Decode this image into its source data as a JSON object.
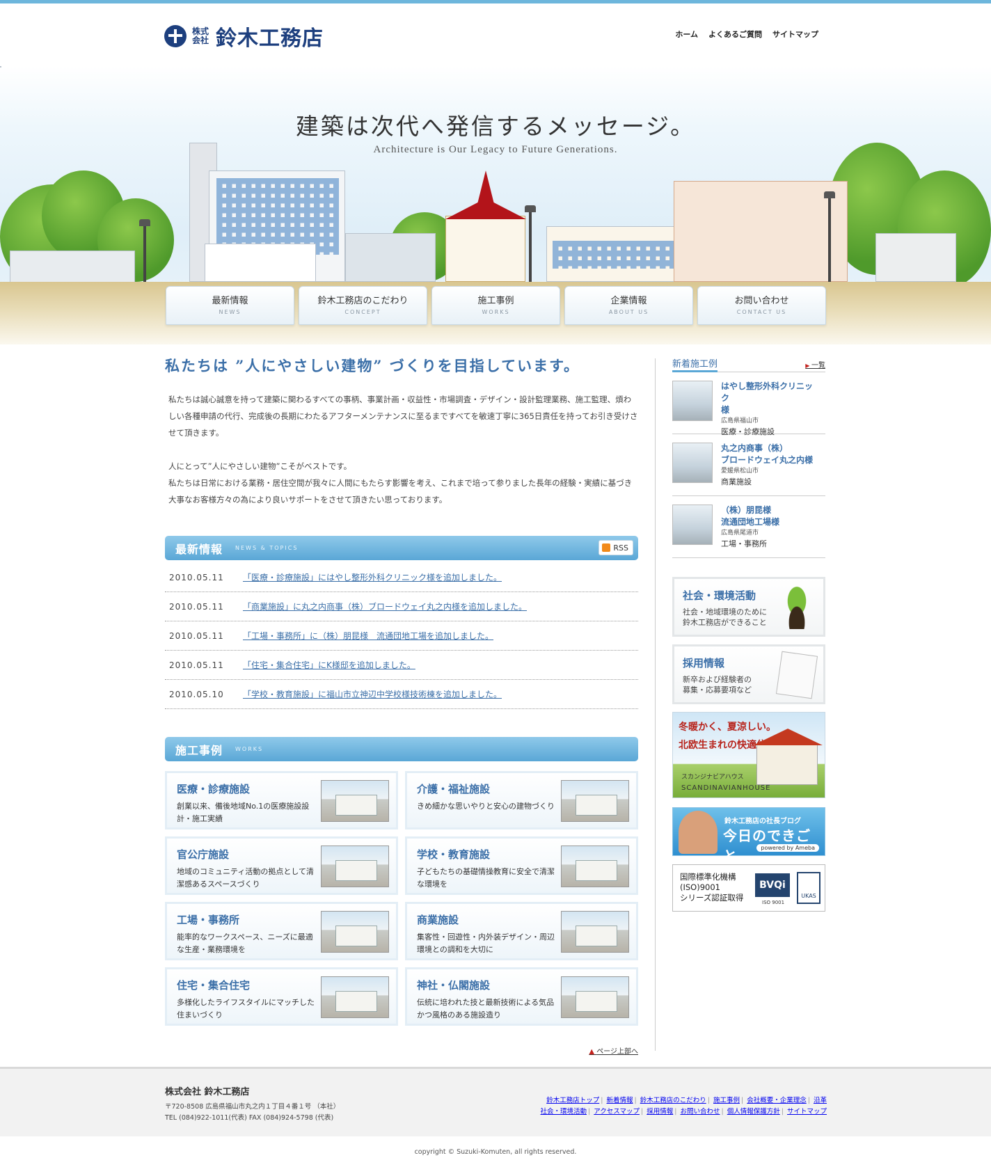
{
  "header": {
    "logo_small": "株式会社",
    "logo_main": "鈴木工務店",
    "top_nav": [
      "ホーム",
      "よくあるご質問",
      "サイトマップ"
    ]
  },
  "hero": {
    "title": "建築は次代へ発信するメッセージ。",
    "subtitle": "Architecture is Our Legacy to Future Generations."
  },
  "main_nav": [
    {
      "jp": "最新情報",
      "en": "NEWS"
    },
    {
      "jp": "鈴木工務店のこだわり",
      "en": "CONCEPT"
    },
    {
      "jp": "施工事例",
      "en": "WORKS"
    },
    {
      "jp": "企業情報",
      "en": "ABOUT US"
    },
    {
      "jp": "お問い合わせ",
      "en": "CONTACT US"
    }
  ],
  "intro": {
    "headline": "私たちは ”人にやさしい建物” づくりを目指しています。",
    "p1": "私たちは誠心誠意を持って建築に関わるすべての事柄、事業計画・収益性・市場調査・デザイン・設計監理業務、施工監理、煩わしい各種申請の代行、完成後の長期にわたるアフターメンテナンスに至るまですべてを敏速丁寧に365日責任を持ってお引き受けさせて頂きます。",
    "p2a": "人にとって”人にやさしい建物”こそがベストです。",
    "p2b": "私たちは日常における業務・居住空間が我々に人間にもたらす影響を考え、これまで培って参りました長年の経験・実績に基づき大事なお客様方々の為により良いサポートをさせて頂きたい思っております。"
  },
  "news": {
    "title": "最新情報",
    "subtitle": "NEWS & TOPICS",
    "rss": "RSS",
    "items": [
      {
        "date": "2010.05.11",
        "text": "「医療・診療施設」にはやし整形外科クリニック様を追加しました。"
      },
      {
        "date": "2010.05.11",
        "text": "「商業施設」に丸之内商事（株）ブロードウェイ丸之内様を追加しました。"
      },
      {
        "date": "2010.05.11",
        "text": "「工場・事務所」に（株）朋昆様　流通団地工場を追加しました。"
      },
      {
        "date": "2010.05.11",
        "text": "「住宅・集合住宅」にK様邸を追加しました。"
      },
      {
        "date": "2010.05.10",
        "text": "「学校・教育施設」に福山市立神辺中学校様技術棟を追加しました。"
      }
    ]
  },
  "works": {
    "title": "施工事例",
    "subtitle": "WORKS",
    "items": [
      {
        "title": "医療・診療施設",
        "desc": "創業以来、備後地域No.1の医療施設設計・施工実績"
      },
      {
        "title": "介護・福祉施設",
        "desc": "きめ細かな思いやりと安心の建物づくり"
      },
      {
        "title": "官公庁施設",
        "desc": "地域のコミュニティ活動の拠点として清潔感あるスペースづくり"
      },
      {
        "title": "学校・教育施設",
        "desc": "子どもたちの基礎情操教育に安全で清潔な環境を"
      },
      {
        "title": "工場・事務所",
        "desc": "能率的なワークスペース、ニーズに最適な生産・業務環境を"
      },
      {
        "title": "商業施設",
        "desc": "集客性・回遊性・内外装デザイン・周辺環境との調和を大切に"
      },
      {
        "title": "住宅・集合住宅",
        "desc": "多様化したライフスタイルにマッチした住まいづくり"
      },
      {
        "title": "神社・仏閣施設",
        "desc": "伝統に培われた技と最新技術による気品かつ風格のある施設造り"
      }
    ],
    "pagetop": "ページ上部へ"
  },
  "sidebar": {
    "new_works_title": "新着施工例",
    "more": "一覧",
    "items": [
      {
        "name1": "はやし整形外科クリニック",
        "name2": "様",
        "pref": "広島県福山市",
        "cat": "医療・診療施設"
      },
      {
        "name1": "丸之内商事（株）",
        "name2": "ブロードウェイ丸之内様",
        "pref": "愛媛県松山市",
        "cat": "商業施設"
      },
      {
        "name1": "（株）朋昆様",
        "name2": "流通団地工場様",
        "pref": "広島県尾道市",
        "cat": "工場・事務所"
      }
    ],
    "eco": {
      "title": "社会・環境活動",
      "desc1": "社会・地域環境のために",
      "desc2": "鈴木工務店ができること"
    },
    "recruit": {
      "title": "採用情報",
      "desc1": "新卒および経験者の",
      "desc2": "募集・応募要項など"
    },
    "scandi": {
      "l1": "冬暖かく、夏涼しい。",
      "l2": "北欧生まれの快適住宅。",
      "l3": "スカンジナビアハウス",
      "l4": "SCANDINAVIANHOUSE"
    },
    "blog": {
      "l1": "鈴木工務店の社長ブログ",
      "l2": "今日のできごと",
      "l3": "powered by Ameba"
    },
    "iso": {
      "text1": "国際標準化機構",
      "text2": "(ISO)9001",
      "text3": "シリーズ認証取得",
      "bvqi": "BVQi",
      "num": "ISO 9001",
      "ukas": "UKAS"
    }
  },
  "footer": {
    "name": "株式会社 鈴木工務店",
    "addr1": "〒720-8508 広島県福山市丸之内１丁目４番１号 （本社）",
    "addr2": "TEL (084)922-1011(代表) FAX (084)924-5798 (代表)",
    "links1": [
      "鈴木工務店トップ",
      "新着情報",
      "鈴木工務店のこだわり",
      "施工事例",
      "会社概要・企業理念",
      "沿革"
    ],
    "links2": [
      "社会・環境活動",
      "アクセスマップ",
      "採用情報",
      "お問い合わせ",
      "個人情報保護方針",
      "サイトマップ"
    ],
    "copyright": "copyright © Suzuki-Komuten, all rights reserved."
  },
  "colors": {
    "accent": "#3b6fa8",
    "bar": "#5aa7d6",
    "brand": "#1d3f7e"
  }
}
